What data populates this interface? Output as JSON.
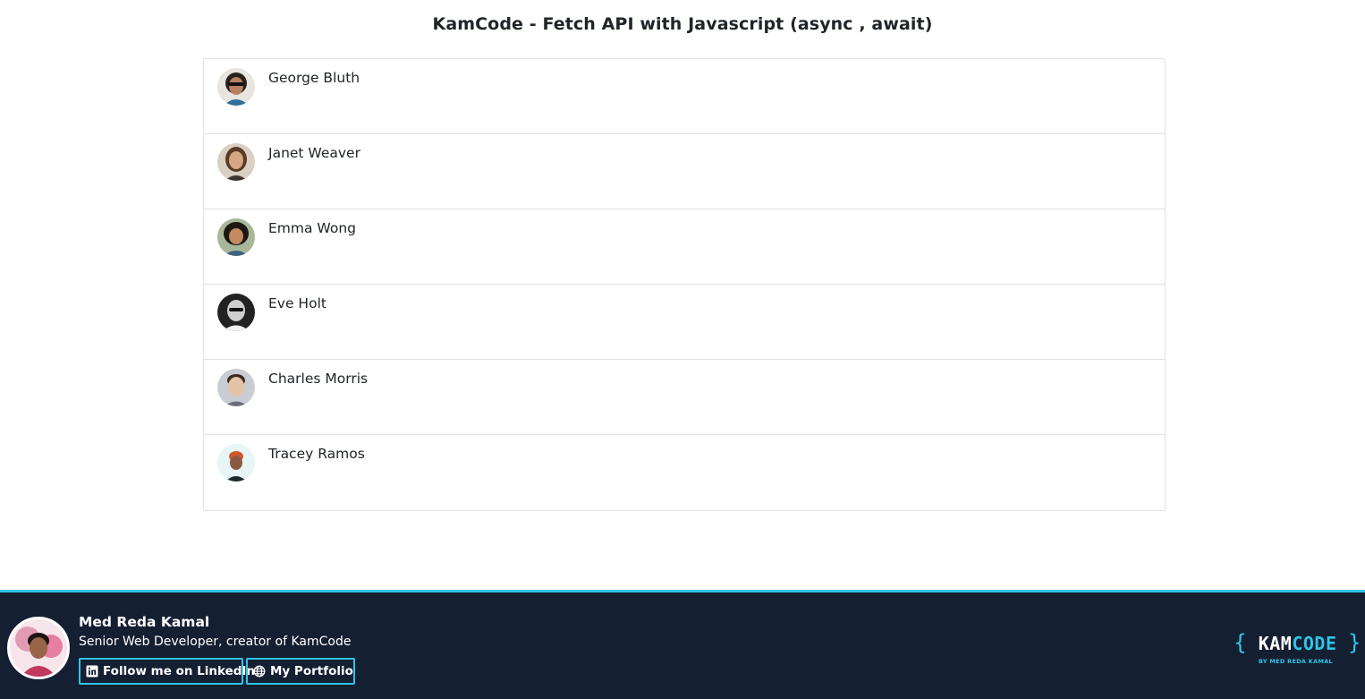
{
  "page": {
    "title": "KamCode - Fetch API with Javascript (async , await)"
  },
  "users": [
    {
      "name": "George Bluth"
    },
    {
      "name": "Janet Weaver"
    },
    {
      "name": "Emma Wong"
    },
    {
      "name": "Eve Holt"
    },
    {
      "name": "Charles Morris"
    },
    {
      "name": "Tracey Ramos"
    }
  ],
  "footer": {
    "author_name": "Med Reda Kamal",
    "author_role": "Senior Web Developer, creator of KamCode",
    "linkedin_label": "Follow me on LinkedIn",
    "portfolio_label": "My Portfolio",
    "brand_left_brace": "{",
    "brand_kam": "KAM",
    "brand_code": "CODE",
    "brand_right_brace": "}",
    "brand_sub": "BY MED REDA KAMAL"
  },
  "colors": {
    "footer_bg": "#151f32",
    "accent": "#2fc4e8",
    "border": "#dfe2e6"
  },
  "icons": {
    "linkedin": "linkedin-icon",
    "portfolio": "globe-icon"
  }
}
